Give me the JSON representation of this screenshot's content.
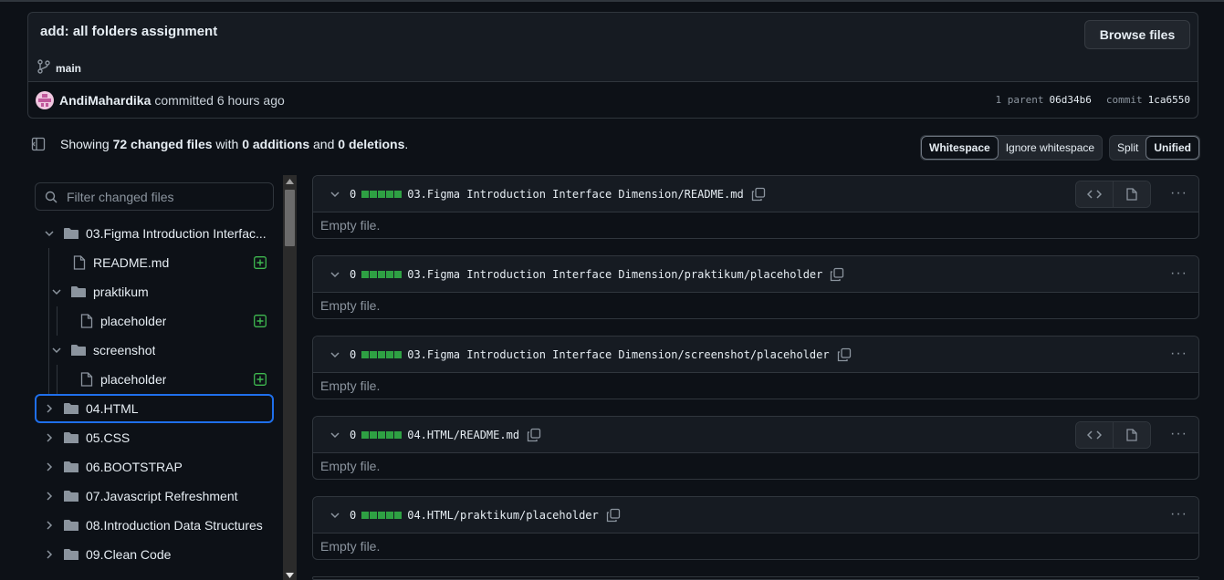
{
  "commit": {
    "title": "add: all folders assignment",
    "browse_label": "Browse files",
    "branch": "main",
    "author": "AndiMahardika",
    "committed_text": "committed 6 hours ago",
    "parent_label": "1 parent",
    "parent_sha": "06d34b6",
    "commit_label": "commit",
    "commit_sha": "1ca6550"
  },
  "summary": {
    "prefix": "Showing",
    "changed": "72 changed files",
    "with": "with",
    "additions": "0 additions",
    "and": "and",
    "deletions": "0 deletions",
    "period": "."
  },
  "whitespace": {
    "whitespace": "Whitespace",
    "ignore": "Ignore whitespace"
  },
  "view_mode": {
    "split": "Split",
    "unified": "Unified"
  },
  "filter": {
    "placeholder": "Filter changed files"
  },
  "tree": [
    {
      "label": "03.Figma Introduction Interface Dimension",
      "display": "03.Figma Introduction Interfac...",
      "type": "folder",
      "expanded": true
    },
    {
      "label": "README.md",
      "type": "file",
      "status": "added"
    },
    {
      "label": "praktikum",
      "type": "folder",
      "expanded": true
    },
    {
      "label": "placeholder",
      "type": "file",
      "status": "added"
    },
    {
      "label": "screenshot",
      "type": "folder",
      "expanded": true
    },
    {
      "label": "placeholder",
      "type": "file",
      "status": "added"
    },
    {
      "label": "04.HTML",
      "type": "folder",
      "expanded": false,
      "selected": true
    },
    {
      "label": "05.CSS",
      "type": "folder",
      "expanded": false
    },
    {
      "label": "06.BOOTSTRAP",
      "type": "folder",
      "expanded": false
    },
    {
      "label": "07.Javascript Refreshment",
      "type": "folder",
      "expanded": false
    },
    {
      "label": "08.Introduction Data Structures",
      "type": "folder",
      "expanded": false
    },
    {
      "label": "09.Clean Code",
      "type": "folder",
      "expanded": false
    }
  ],
  "diffs": [
    {
      "count": "0",
      "path": "03.Figma Introduction Interface Dimension/README.md",
      "empty_text": "Empty file.",
      "view_buttons": true
    },
    {
      "count": "0",
      "path": "03.Figma Introduction Interface Dimension/praktikum/placeholder",
      "empty_text": "Empty file.",
      "view_buttons": false
    },
    {
      "count": "0",
      "path": "03.Figma Introduction Interface Dimension/screenshot/placeholder",
      "empty_text": "Empty file.",
      "view_buttons": false
    },
    {
      "count": "0",
      "path": "04.HTML/README.md",
      "empty_text": "Empty file.",
      "view_buttons": true
    },
    {
      "count": "0",
      "path": "04.HTML/praktikum/placeholder",
      "empty_text": "Empty file.",
      "view_buttons": false
    }
  ],
  "colors": {
    "background": "#0d1117",
    "border": "#30363d",
    "added": "#2ea043",
    "focus": "#1f6feb"
  }
}
